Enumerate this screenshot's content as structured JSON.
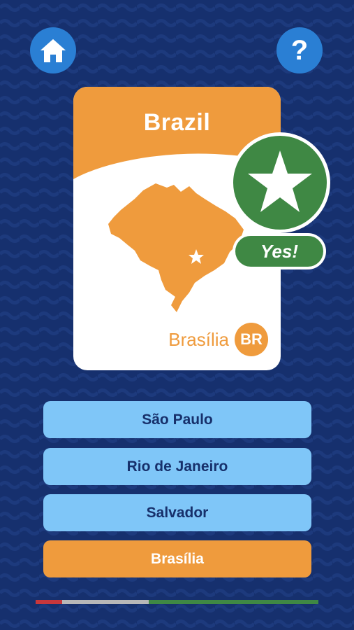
{
  "header": {
    "home_icon": "home-icon",
    "help_icon": "question-mark-icon",
    "help_glyph": "?"
  },
  "card": {
    "country": "Brazil",
    "capital": "Brasília",
    "code": "BR",
    "map_icon": "brazil-map",
    "capital_marker_icon": "star-icon"
  },
  "result": {
    "icon": "star-icon",
    "label": "Yes!"
  },
  "answers": [
    {
      "label": "São Paulo",
      "state": "normal"
    },
    {
      "label": "Rio de Janeiro",
      "state": "normal"
    },
    {
      "label": "Salvador",
      "state": "normal"
    },
    {
      "label": "Brasília",
      "state": "selected"
    }
  ],
  "progress": {
    "segments": [
      {
        "status": "wrong",
        "color": "#c8373b",
        "fraction": 0.095
      },
      {
        "status": "skipped",
        "color": "#b8b8b8",
        "fraction": 0.305
      },
      {
        "status": "correct",
        "color": "#3f8844",
        "fraction": 0.6
      }
    ]
  },
  "colors": {
    "background": "#16306e",
    "button_blue": "#2a7fd4",
    "accent_orange": "#ef9b3d",
    "success_green": "#3f8844",
    "answer_blue": "#7fc6f8",
    "answer_text": "#17306b"
  }
}
